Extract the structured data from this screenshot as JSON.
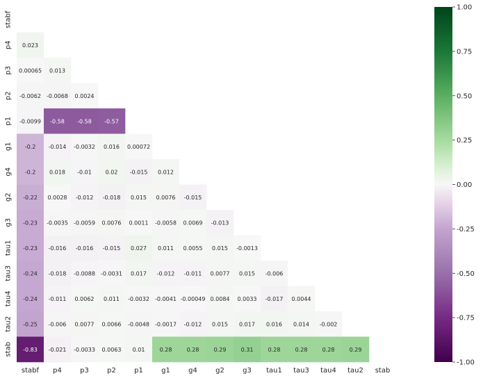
{
  "chart_data": {
    "type": "heatmap",
    "labels": [
      "stabf",
      "p4",
      "p3",
      "p2",
      "p1",
      "g1",
      "g4",
      "g2",
      "g3",
      "tau1",
      "tau3",
      "tau4",
      "tau2",
      "stab"
    ],
    "x_labels": [
      "stabf",
      "p4",
      "p3",
      "p2",
      "p1",
      "g1",
      "g4",
      "g2",
      "g3",
      "tau1",
      "tau3",
      "tau4",
      "tau2",
      "stab"
    ],
    "y_labels": [
      "stabf",
      "p4",
      "p3",
      "p2",
      "p1",
      "g1",
      "g4",
      "g2",
      "g3",
      "tau1",
      "tau3",
      "tau4",
      "tau2",
      "stab"
    ],
    "mask": "upper triangle including diagonal",
    "values": [
      [],
      [
        "0.023"
      ],
      [
        "0.00065",
        "0.013"
      ],
      [
        "-0.0062",
        "-0.0068",
        "0.0024"
      ],
      [
        "-0.0099",
        "-0.58",
        "-0.58",
        "-0.57"
      ],
      [
        "-0.2",
        "-0.014",
        "-0.0032",
        "0.016",
        "0.00072"
      ],
      [
        "-0.2",
        "0.018",
        "-0.01",
        "0.02",
        "-0.015",
        "0.012"
      ],
      [
        "-0.22",
        "0.0028",
        "-0.012",
        "-0.018",
        "0.015",
        "0.0076",
        "-0.015"
      ],
      [
        "-0.23",
        "-0.0035",
        "-0.0059",
        "0.0076",
        "0.0011",
        "-0.0058",
        "0.0069",
        "-0.013"
      ],
      [
        "-0.23",
        "-0.016",
        "-0.016",
        "-0.015",
        "0.027",
        "0.011",
        "0.0055",
        "0.015",
        "-0.0013"
      ],
      [
        "-0.24",
        "-0.018",
        "-0.0088",
        "-0.0031",
        "0.017",
        "-0.012",
        "-0.011",
        "0.0077",
        "0.015",
        "-0.006"
      ],
      [
        "-0.24",
        "-0.011",
        "0.0062",
        "0.011",
        "-0.0032",
        "-0.0041",
        "-0.00049",
        "0.0084",
        "0.0033",
        "-0.017",
        "0.0044"
      ],
      [
        "-0.25",
        "-0.006",
        "0.0077",
        "0.0066",
        "-0.0048",
        "-0.0017",
        "-0.012",
        "0.015",
        "0.017",
        "0.016",
        "0.014",
        "-0.002"
      ],
      [
        "-0.83",
        "-0.021",
        "-0.0033",
        "0.0063",
        "0.01",
        "0.28",
        "0.28",
        "0.29",
        "0.31",
        "0.28",
        "0.28",
        "0.28",
        "0.29"
      ]
    ],
    "vmin": -1.0,
    "vmax": 1.0,
    "colormap": "PRGn",
    "colorbar_ticks": [
      "1.00",
      "0.75",
      "0.50",
      "0.25",
      "0.00",
      "-0.25",
      "-0.50",
      "-0.75",
      "-1.00"
    ]
  }
}
